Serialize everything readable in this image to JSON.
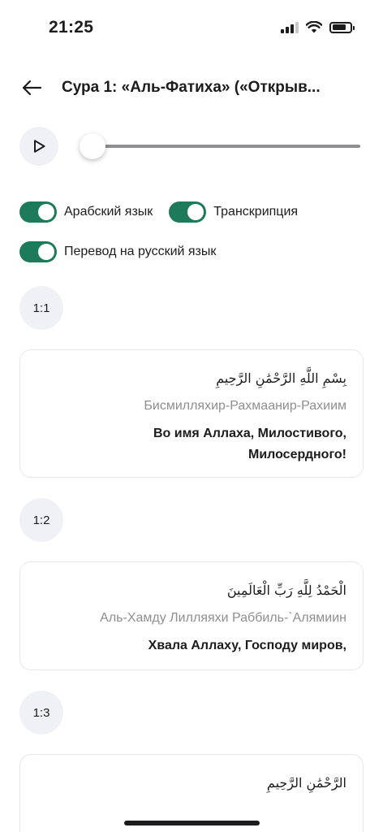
{
  "status_bar": {
    "time": "21:25",
    "icons": [
      "cellular-signal-icon",
      "wifi-icon",
      "battery-icon"
    ]
  },
  "header": {
    "back_icon": "arrow-left-icon",
    "title": "Сура 1: «Аль-Фатиха» («Открыв..."
  },
  "player": {
    "play_icon": "play-icon",
    "progress": 0
  },
  "toggles": [
    {
      "label": "Арабский язык",
      "on": true
    },
    {
      "label": "Транскрипция",
      "on": true
    },
    {
      "label": "Перевод на русский язык",
      "on": true
    }
  ],
  "verses": [
    {
      "number": "1:1",
      "arabic": "بِسْمِ اللَّهِ الرَّحْمَٰنِ الرَّحِيمِ",
      "transliteration": "Бисмилляхир-Рахмаанир-Рахиим",
      "translation": "Во имя Аллаха, Милостивого, Милосердного!"
    },
    {
      "number": "1:2",
      "arabic": "الْحَمْدُ لِلَّهِ رَبِّ الْعَالَمِينَ",
      "transliteration": "Аль-Хамду Лилляяхи Раббиль-`Алямиин",
      "translation": "Хвала Аллаху, Господу миров,"
    },
    {
      "number": "1:3",
      "arabic": "الرَّحْمَٰنِ الرَّحِيمِ",
      "transliteration": "",
      "translation": ""
    }
  ],
  "colors": {
    "accent": "#1d7a5a",
    "muted_text": "#8e8e93",
    "badge_bg": "#f0f1f6",
    "card_border": "#e6e7ec"
  }
}
